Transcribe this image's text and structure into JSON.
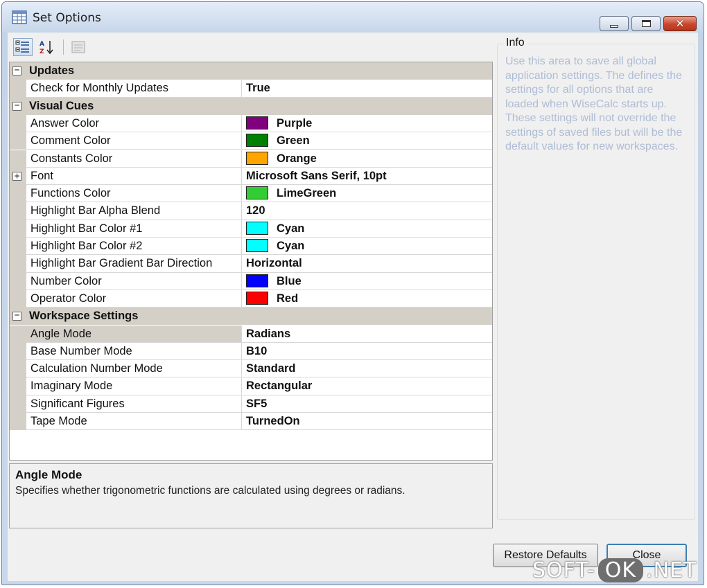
{
  "window": {
    "title": "Set Options",
    "icon": "table-grid-icon",
    "controls": [
      "minimize-icon",
      "maximize-icon",
      "close-icon"
    ]
  },
  "toolbar": {
    "buttons": [
      {
        "name": "categorized-icon",
        "active": true
      },
      {
        "name": "alphabetical-sort-icon",
        "active": false
      },
      {
        "name": "property-pages-icon",
        "active": false
      }
    ]
  },
  "grid": {
    "categories": [
      {
        "label": "Updates",
        "expanded_glyph": "−",
        "properties": [
          {
            "name": "Check for Monthly Updates",
            "value": "True"
          }
        ]
      },
      {
        "label": "Visual Cues",
        "expanded_glyph": "−",
        "properties": [
          {
            "name": "Answer Color",
            "value": "Purple",
            "swatch": "#800080"
          },
          {
            "name": "Comment Color",
            "value": "Green",
            "swatch": "#008000"
          },
          {
            "name": "Constants Color",
            "value": "Orange",
            "swatch": "#ffa500"
          },
          {
            "name": "Font",
            "value": "Microsoft Sans Serif, 10pt",
            "collapsed_glyph": "+"
          },
          {
            "name": "Functions Color",
            "value": "LimeGreen",
            "swatch": "#32cd32"
          },
          {
            "name": "Highlight Bar Alpha Blend",
            "value": "120"
          },
          {
            "name": "Highlight Bar Color #1",
            "value": "Cyan",
            "swatch": "#00ffff"
          },
          {
            "name": "Highlight Bar Color #2",
            "value": "Cyan",
            "swatch": "#00ffff"
          },
          {
            "name": "Highlight Bar Gradient Bar Direction",
            "value": "Horizontal"
          },
          {
            "name": "Number Color",
            "value": "Blue",
            "swatch": "#0000ff"
          },
          {
            "name": "Operator Color",
            "value": "Red",
            "swatch": "#ff0000"
          }
        ]
      },
      {
        "label": "Workspace Settings",
        "expanded_glyph": "−",
        "properties": [
          {
            "name": "Angle Mode",
            "value": "Radians",
            "selected": true
          },
          {
            "name": "Base Number Mode",
            "value": "B10"
          },
          {
            "name": "Calculation Number Mode",
            "value": "Standard"
          },
          {
            "name": "Imaginary Mode",
            "value": "Rectangular"
          },
          {
            "name": "Significant Figures",
            "value": "SF5"
          },
          {
            "name": "Tape Mode",
            "value": "TurnedOn"
          }
        ]
      }
    ]
  },
  "description": {
    "title": "Angle Mode",
    "text": "Specifies whether trigonometric functions are calculated using degrees or radians."
  },
  "info": {
    "legend": "Info",
    "text": "Use this area to save all global application settings.  The defines the settings for all options that are loaded when WiseCalc starts up. These settings will not override the settings of saved files but will be the default values for new workspaces."
  },
  "buttons": {
    "restore_label": "Restore Defaults",
    "close_label": "Close"
  },
  "watermark": {
    "left": "SOFT-",
    "mid": "OK",
    "right": ".NET"
  }
}
